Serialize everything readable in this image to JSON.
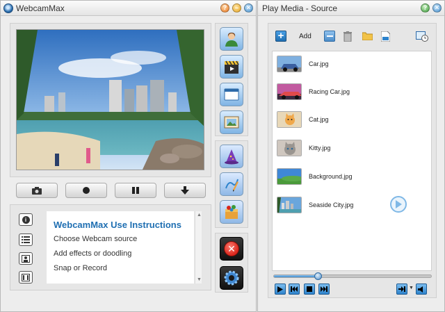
{
  "left_window": {
    "title": "WebcamMax",
    "instructions": {
      "title": "WebcamMax Use Instructions",
      "steps": [
        "Choose Webcam source",
        "Add effects or doodling",
        "Snap or Record"
      ]
    }
  },
  "right_window": {
    "title": "Play Media - Source",
    "toolbar": {
      "add_label": "Add"
    },
    "media_items": [
      {
        "name": "Car.jpg"
      },
      {
        "name": "Racing Car.jpg"
      },
      {
        "name": "Cat.jpg"
      },
      {
        "name": "Kitty.jpg"
      },
      {
        "name": "Background.jpg"
      },
      {
        "name": "Seaside City.jpg"
      }
    ],
    "seek_position": 0.28
  },
  "colors": {
    "accent": "#1f6fb2",
    "close_red": "#d9261c",
    "playback_blue": "#2d83cc"
  },
  "icons": {
    "left_titlebar": [
      "webcam-logo-icon",
      "help-icon",
      "minimize-icon",
      "close-icon"
    ],
    "tools": [
      "user-avatar-icon",
      "media-clapper-icon",
      "window-icon",
      "picture-icon",
      "wizard-hat-icon",
      "doodle-pencil-icon",
      "effects-box-icon",
      "stop-icon",
      "settings-gear-icon"
    ]
  }
}
